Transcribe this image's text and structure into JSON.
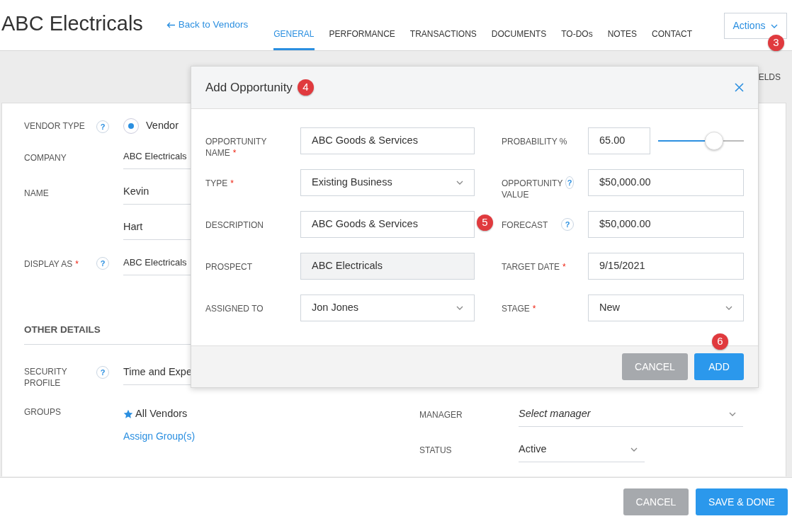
{
  "header": {
    "title": "ABC Electricals",
    "back_link": "Back to Vendors",
    "tabs": [
      {
        "label": "GENERAL",
        "selected": true
      },
      {
        "label": "PERFORMANCE",
        "selected": false
      },
      {
        "label": "TRANSACTIONS",
        "selected": false
      },
      {
        "label": "DOCUMENTS",
        "selected": false
      },
      {
        "label": "TO-DOs",
        "selected": false
      },
      {
        "label": "NOTES",
        "selected": false
      },
      {
        "label": "CONTACT",
        "selected": false
      }
    ],
    "actions_button": "Actions",
    "marker": "3"
  },
  "toolbar_text": "ELDS",
  "vendor_form": {
    "fields": [
      {
        "kind": "radio",
        "label": "VENDOR TYPE",
        "help": "?",
        "value": "Vendor",
        "selected": true
      },
      {
        "kind": "text",
        "label": "COMPANY",
        "value": "ABC Electricals"
      },
      {
        "kind": "multi",
        "label": "NAME",
        "values": [
          "Kevin",
          "Hart"
        ]
      },
      {
        "kind": "text",
        "label": "DISPLAY AS",
        "required_mark": "*",
        "help": "?",
        "value": "ABC Electricals"
      }
    ],
    "section_title": "OTHER DETAILS",
    "left_fields": [
      {
        "kind": "text",
        "label": "SECURITY PROFILE",
        "help": "?",
        "value": "Time and Expe"
      },
      {
        "kind": "groups",
        "label": "GROUPS",
        "value": "All Vendors",
        "link": "Assign Group(s)"
      }
    ],
    "right_fields": [
      {
        "kind": "select",
        "label": "MANAGER",
        "placeholder": "Select manager"
      },
      {
        "kind": "select",
        "label": "STATUS",
        "value": "Active"
      }
    ]
  },
  "footer": {
    "cancel": "CANCEL",
    "save": "SAVE & DONE"
  },
  "modal": {
    "title": "Add Opportunity",
    "marker": "4",
    "side_marker": "5",
    "footer_marker": "6",
    "left_fields": [
      {
        "kind": "text",
        "label": "OPPORTUNITY NAME",
        "required_mark": "*",
        "value": "ABC Goods & Services"
      },
      {
        "kind": "select",
        "label": "TYPE",
        "required_mark": "*",
        "value": "Existing Business"
      },
      {
        "kind": "text",
        "label": "DESCRIPTION",
        "value": "ABC Goods & Services"
      },
      {
        "kind": "text",
        "label": "PROSPECT",
        "value": "ABC Electricals",
        "disabled": true
      },
      {
        "kind": "select",
        "label": "ASSIGNED TO",
        "value": "Jon Jones"
      }
    ],
    "right_fields": [
      {
        "kind": "slider",
        "label": "PROBABILITY %",
        "value": "65.00",
        "level": 0.65
      },
      {
        "kind": "text",
        "label": "OPPORTUNITY VALUE",
        "help": "?",
        "value": "$50,000.00"
      },
      {
        "kind": "text",
        "label": "FORECAST",
        "help": "?",
        "value": "$50,000.00"
      },
      {
        "kind": "text",
        "label": "TARGET DATE",
        "required_mark": "*",
        "value": "9/15/2021"
      },
      {
        "kind": "select",
        "label": "STAGE",
        "required_mark": "*",
        "value": "New"
      }
    ],
    "cancel": "CANCEL",
    "add": "ADD"
  }
}
